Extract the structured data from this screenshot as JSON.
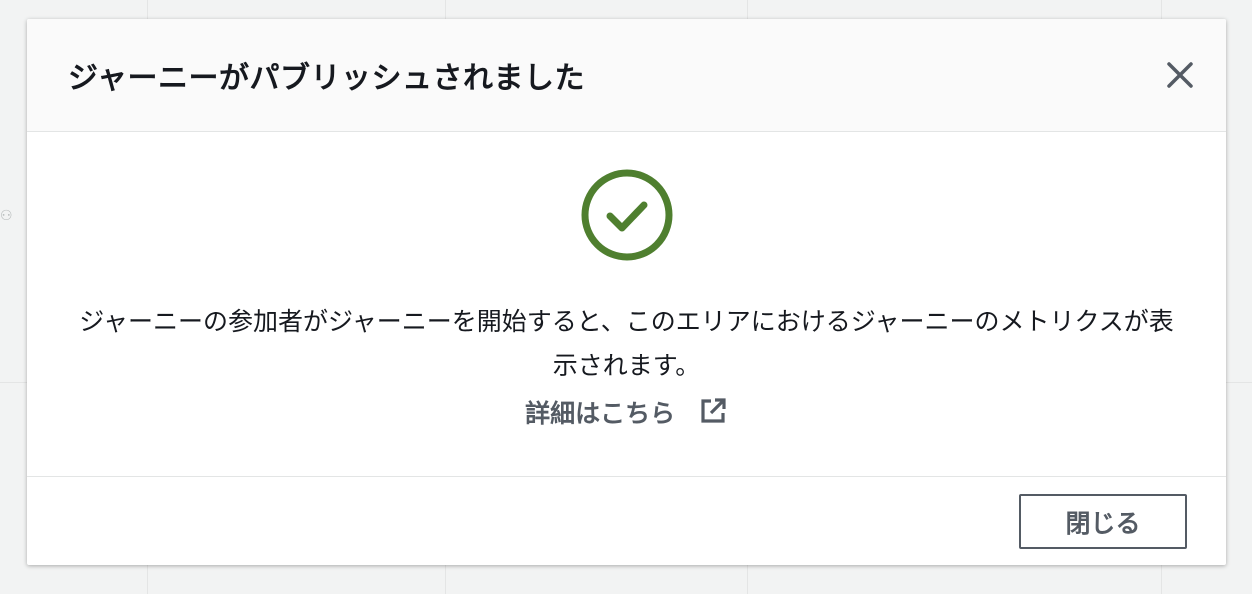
{
  "modal": {
    "title": "ジャーニーがパブリッシュされました",
    "close_icon": "close-icon",
    "success_icon": "check-circle-icon",
    "message": "ジャーニーの参加者がジャーニーを開始すると、このエリアにおけるジャーニーのメトリクスが表示されます。",
    "learn_more_label": "詳細はこちら",
    "learn_more_icon": "external-link-icon",
    "close_button_label": "閉じる"
  },
  "colors": {
    "success": "#4f7f2f",
    "text_primary": "#16191f",
    "text_secondary": "#545b64",
    "header_bg": "#fafafa",
    "backdrop": "#f2f3f3"
  }
}
